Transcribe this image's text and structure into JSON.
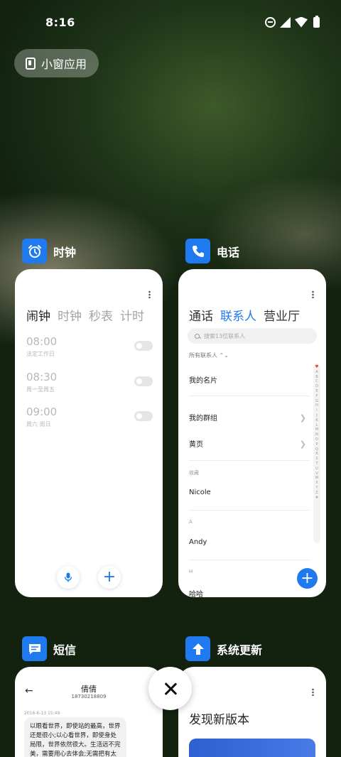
{
  "status_bar": {
    "time": "8:16"
  },
  "mini_window": {
    "label": "小窗应用"
  },
  "clock": {
    "app_title": "时钟",
    "tabs": [
      "闹钟",
      "时钟",
      "秒表",
      "计时"
    ],
    "alarms": [
      {
        "time": "08:00",
        "repeat": "法定工作日",
        "enabled": false
      },
      {
        "time": "08:30",
        "repeat": "周一至周五",
        "enabled": false
      },
      {
        "time": "09:00",
        "repeat": "周六 周日",
        "enabled": false
      }
    ],
    "add_label": "+"
  },
  "phone": {
    "app_title": "电话",
    "tabs": [
      "通话",
      "联系人",
      "营业厅"
    ],
    "search_placeholder": "搜索13位联系人",
    "filter_label": "所有联系人 ⌃⌄",
    "my_card": "我的名片",
    "my_groups": "我的群组",
    "yellow_pages": "黄页",
    "sections": [
      {
        "label": "收藏",
        "contact": "Nicole"
      },
      {
        "label": "A",
        "contact": "Andy"
      },
      {
        "label": "H",
        "contact": "哈哈"
      }
    ],
    "alphabet": [
      "♥",
      "A",
      "B",
      "C",
      "D",
      "E",
      "F",
      "G",
      "H",
      "I",
      "J",
      "K",
      "L",
      "M",
      "N",
      "O",
      "P",
      "Q",
      "R",
      "S",
      "T",
      "U",
      "V",
      "W",
      "X",
      "Y",
      "Z",
      "#"
    ],
    "fab_label": "+"
  },
  "sms": {
    "app_title": "短信",
    "contact_name": "倩倩",
    "contact_number": "18730218809",
    "date": "2016-6-13 15:49",
    "message": "以眼看世界，即使站的最高，世界还是很小;以心看世界，即使身处局限，世界依然很大。生活远不完美，需要用心去体会;无需把有太多..."
  },
  "update": {
    "app_title": "系统更新",
    "heading": "发现新版本"
  },
  "colors": {
    "accent": "#1f7af0"
  }
}
